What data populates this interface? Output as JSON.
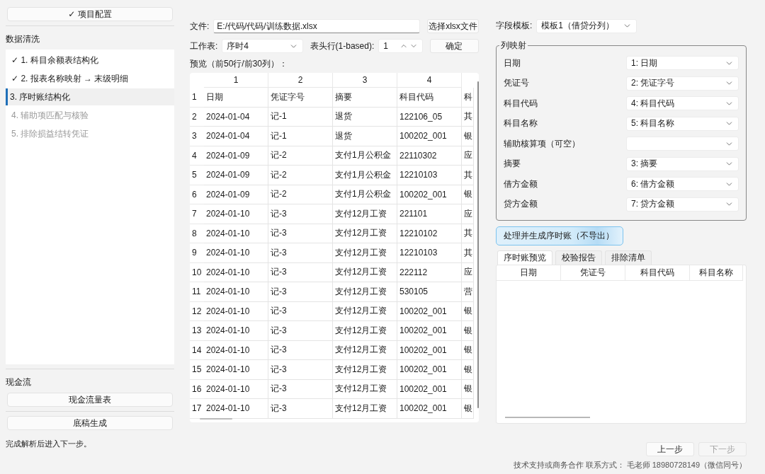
{
  "sidebar": {
    "project_button": "✓ 项目配置",
    "data_cleaning": {
      "title": "数据清洗",
      "steps": [
        {
          "label": "✓ 1. 科目余额表结构化",
          "selected": false,
          "disabled": false
        },
        {
          "label": "✓ 2. 报表名称映射 → 末级明细",
          "selected": false,
          "disabled": false
        },
        {
          "label": "3. 序时账结构化",
          "selected": true,
          "disabled": false
        },
        {
          "label": "4. 辅助项匹配与核验",
          "selected": false,
          "disabled": true
        },
        {
          "label": "5. 排除损益结转凭证",
          "selected": false,
          "disabled": true
        }
      ]
    },
    "cash_flow": {
      "title": "现金流",
      "button": "现金流量表"
    },
    "draft_button": "底稿生成",
    "status": "完成解析后进入下一步。"
  },
  "file": {
    "label": "文件:",
    "value": "E:/代码/代码/训练数据.xlsx",
    "browse_button": "选择xlsx文件"
  },
  "sheet": {
    "label": "工作表:",
    "value": "序时4"
  },
  "header_row": {
    "label": "表头行(1-based):",
    "value": "1"
  },
  "confirm_button": "确定",
  "preview": {
    "label": "预览（前50行/前30列）：",
    "columns": [
      "1",
      "2",
      "3",
      "4"
    ],
    "rows": [
      {
        "row_number": "1",
        "cells": [
          "日期",
          "凭证字号",
          "摘要",
          "科目代码",
          "科"
        ]
      },
      {
        "row_number": "2",
        "cells": [
          "2024-01-04",
          "记-1",
          "退货",
          "122106_05",
          "其"
        ]
      },
      {
        "row_number": "3",
        "cells": [
          "2024-01-04",
          "记-1",
          "退货",
          "100202_001",
          "银"
        ]
      },
      {
        "row_number": "4",
        "cells": [
          "2024-01-09",
          "记-2",
          "支付1月公积金",
          "22110302",
          "应"
        ]
      },
      {
        "row_number": "5",
        "cells": [
          "2024-01-09",
          "记-2",
          "支付1月公积金",
          "12210103",
          "其"
        ]
      },
      {
        "row_number": "6",
        "cells": [
          "2024-01-09",
          "记-2",
          "支付1月公积金",
          "100202_001",
          "银"
        ]
      },
      {
        "row_number": "7",
        "cells": [
          "2024-01-10",
          "记-3",
          "支付12月工资",
          "221101",
          "应"
        ]
      },
      {
        "row_number": "8",
        "cells": [
          "2024-01-10",
          "记-3",
          "支付12月工资",
          "12210102",
          "其"
        ]
      },
      {
        "row_number": "9",
        "cells": [
          "2024-01-10",
          "记-3",
          "支付12月工资",
          "12210103",
          "其"
        ]
      },
      {
        "row_number": "10",
        "cells": [
          "2024-01-10",
          "记-3",
          "支付12月工资",
          "222112",
          "应"
        ]
      },
      {
        "row_number": "11",
        "cells": [
          "2024-01-10",
          "记-3",
          "支付12月工资",
          "530105",
          "营"
        ]
      },
      {
        "row_number": "12",
        "cells": [
          "2024-01-10",
          "记-3",
          "支付12月工资",
          "100202_001",
          "银"
        ]
      },
      {
        "row_number": "13",
        "cells": [
          "2024-01-10",
          "记-3",
          "支付12月工资",
          "100202_001",
          "银"
        ]
      },
      {
        "row_number": "14",
        "cells": [
          "2024-01-10",
          "记-3",
          "支付12月工资",
          "100202_001",
          "银"
        ]
      },
      {
        "row_number": "15",
        "cells": [
          "2024-01-10",
          "记-3",
          "支付12月工资",
          "100202_001",
          "银"
        ]
      },
      {
        "row_number": "16",
        "cells": [
          "2024-01-10",
          "记-3",
          "支付12月工资",
          "100202_001",
          "银"
        ]
      },
      {
        "row_number": "17",
        "cells": [
          "2024-01-10",
          "记-3",
          "支付12月工资",
          "100202_001",
          "银"
        ]
      }
    ]
  },
  "template": {
    "label": "字段模板:",
    "value": "模板1（借贷分列）"
  },
  "mapping": {
    "title": "列映射",
    "fields": [
      {
        "label": "日期",
        "value": "1: 日期"
      },
      {
        "label": "凭证号",
        "value": "2: 凭证字号"
      },
      {
        "label": "科目代码",
        "value": "4: 科目代码"
      },
      {
        "label": "科目名称",
        "value": "5: 科目名称"
      },
      {
        "label": "辅助核算项（可空）"
      },
      {
        "label": "摘要",
        "value": "3: 摘要"
      },
      {
        "label": "借方金额",
        "value": "6: 借方金额"
      },
      {
        "label": "贷方金额",
        "value": "7: 贷方金额"
      }
    ]
  },
  "process_button": "处理并生成序时账（不导出）",
  "result_tabs": [
    {
      "label": "序时账预览",
      "selected": true
    },
    {
      "label": "校验报告",
      "selected": false
    },
    {
      "label": "排除清单",
      "selected": false
    }
  ],
  "result_table": {
    "columns": [
      "日期",
      "凭证号",
      "科目代码",
      "科目名称"
    ]
  },
  "nav": {
    "prev": {
      "label": "上一步",
      "disabled": false
    },
    "next": {
      "label": "下一步",
      "disabled": true
    }
  },
  "footer": "技术支持或商务合作 联系方式：  毛老师 18980728149（微信同号）"
}
